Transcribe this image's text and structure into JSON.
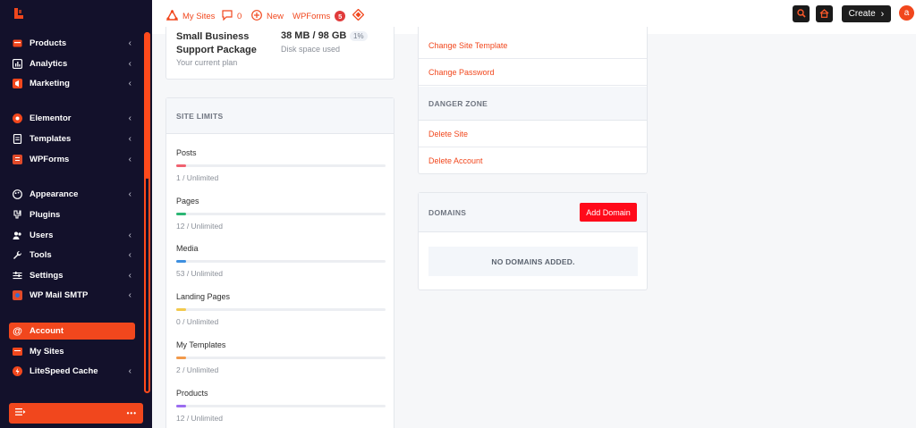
{
  "sidebar": {
    "items": [
      {
        "label": "Products",
        "icon": "box-icon",
        "chevron": true
      },
      {
        "label": "Analytics",
        "icon": "chart-icon",
        "chevron": true
      },
      {
        "label": "Marketing",
        "icon": "megaphone-icon",
        "chevron": true
      },
      {
        "label": "Elementor",
        "icon": "elementor-icon",
        "chevron": true
      },
      {
        "label": "Templates",
        "icon": "document-icon",
        "chevron": true
      },
      {
        "label": "WPForms",
        "icon": "wpforms-icon",
        "chevron": true
      },
      {
        "label": "Appearance",
        "icon": "palette-icon",
        "chevron": true
      },
      {
        "label": "Plugins",
        "icon": "plug-icon",
        "chevron": false
      },
      {
        "label": "Users",
        "icon": "users-icon",
        "chevron": true
      },
      {
        "label": "Tools",
        "icon": "wrench-icon",
        "chevron": true
      },
      {
        "label": "Settings",
        "icon": "sliders-icon",
        "chevron": true
      },
      {
        "label": "WP Mail SMTP",
        "icon": "mail-icon",
        "chevron": true
      },
      {
        "label": "Account",
        "icon": "at-icon",
        "chevron": false,
        "active": true
      },
      {
        "label": "My Sites",
        "icon": "sites-icon",
        "chevron": false
      },
      {
        "label": "LiteSpeed Cache",
        "icon": "litespeed-icon",
        "chevron": true
      }
    ],
    "collapse_more": "•••"
  },
  "topbar": {
    "my_sites": "My Sites",
    "comments_count": "0",
    "new_label": "New",
    "wpforms_label": "WPForms",
    "wpforms_badge": "5",
    "create_label": "Create",
    "avatar_initial": "a"
  },
  "plan": {
    "name": "Small Business Support Package",
    "sub": "Your current plan",
    "disk_value": "38 MB / 98 GB",
    "disk_percent": "1%",
    "disk_sub": "Disk space used"
  },
  "site_limits": {
    "title": "SITE LIMITS",
    "items": [
      {
        "name": "Posts",
        "count": "1 / Unlimited",
        "color": "#f0616f"
      },
      {
        "name": "Pages",
        "count": "12 / Unlimited",
        "color": "#2bb673"
      },
      {
        "name": "Media",
        "count": "53 / Unlimited",
        "color": "#3d8fe0"
      },
      {
        "name": "Landing Pages",
        "count": "0 / Unlimited",
        "color": "#f2c94c"
      },
      {
        "name": "My Templates",
        "count": "2 / Unlimited",
        "color": "#f2994a"
      },
      {
        "name": "Products",
        "count": "12 / Unlimited",
        "color": "#9b6cf0"
      }
    ]
  },
  "settings": {
    "change_template": "Change Site Template",
    "change_password": "Change Password",
    "danger_zone": "DANGER ZONE",
    "delete_site": "Delete Site",
    "delete_account": "Delete Account"
  },
  "domains": {
    "title": "DOMAINS",
    "add_button": "Add Domain",
    "empty": "NO DOMAINS ADDED."
  },
  "colors": {
    "accent": "#f1471d",
    "sidebar_bg": "#13112b",
    "add_domain": "#ff0a1a"
  }
}
